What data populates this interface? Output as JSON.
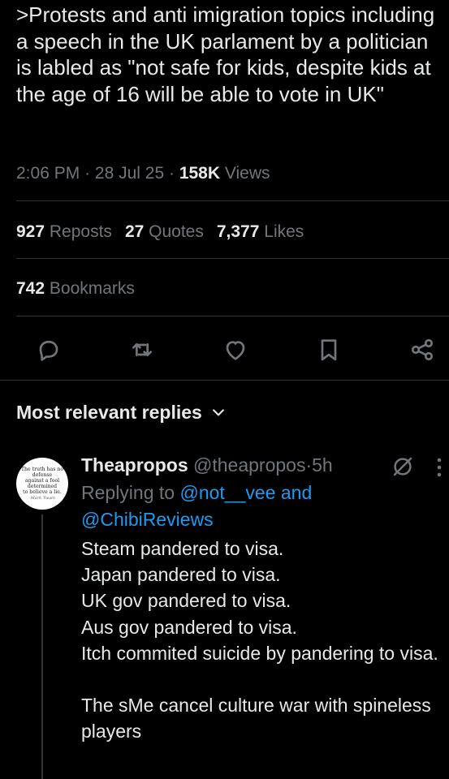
{
  "tweet": {
    "text": ">Protests and anti imigration topics including a speech in the UK parlament by a politician is labled as \"not safe for kids, despite kids at the age of 16 will be able to vote in UK\"",
    "time": "2:06 PM",
    "date": "28 Jul 25",
    "views_count": "158K",
    "views_label": "Views",
    "separator": "·"
  },
  "stats": {
    "reposts_count": "927",
    "reposts_label": "Reposts",
    "quotes_count": "27",
    "quotes_label": "Quotes",
    "likes_count": "7,377",
    "likes_label": "Likes",
    "bookmarks_count": "742",
    "bookmarks_label": "Bookmarks"
  },
  "actions": {
    "icons": [
      "reply-icon",
      "repost-icon",
      "like-icon",
      "bookmark-icon",
      "share-icon"
    ]
  },
  "replies_section": {
    "header": "Most relevant replies"
  },
  "reply": {
    "avatar_text": [
      "The truth has no",
      "defense",
      "against a fool",
      "determined",
      "to believe a lie."
    ],
    "avatar_signature": "-Mark Twain",
    "name": "Theapropos",
    "handle": "@theapropos",
    "separator": "·",
    "time": "5h",
    "replying_prefix": "Replying to",
    "mention_1": "@not__vee",
    "and_word": "and",
    "mention_2": "@ChibiReviews",
    "body": "Steam pandered to visa.\nJapan pandered to visa.\nUK gov pandered to visa.\nAus gov pandered to visa.\nItch commited suicide by pandering to visa.\n\nThe sMe cancel culture war with spineless players"
  },
  "colors": {
    "background": "#000000",
    "text": "#e7e9ea",
    "muted": "#71767b",
    "link": "#1d9bf0",
    "divider": "#2f3336"
  }
}
